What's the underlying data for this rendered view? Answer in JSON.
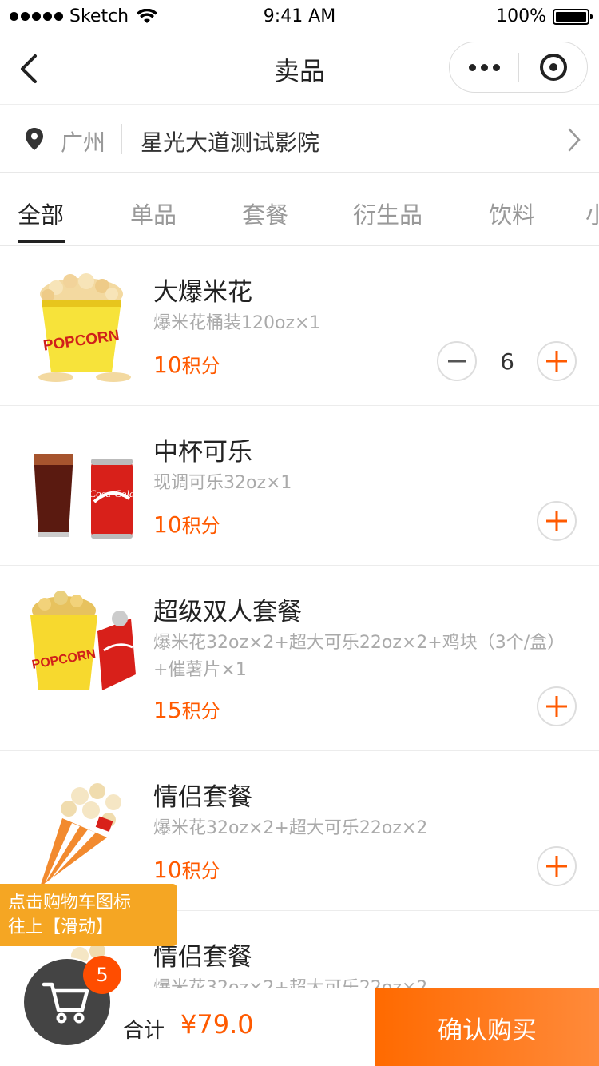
{
  "status_bar": {
    "carrier": "Sketch",
    "time": "9:41 AM",
    "battery": "100%"
  },
  "nav": {
    "title": "卖品"
  },
  "location": {
    "city": "广州",
    "cinema": "星光大道测试影院"
  },
  "tabs": [
    {
      "label": "全部",
      "active": true
    },
    {
      "label": "单品",
      "active": false
    },
    {
      "label": "套餐",
      "active": false
    },
    {
      "label": "衍生品",
      "active": false
    },
    {
      "label": "饮料",
      "active": false
    },
    {
      "label": "小",
      "active": false
    }
  ],
  "products": [
    {
      "name": "大爆米花",
      "desc": "爆米花桶装120oz×1",
      "price": "10",
      "price_unit": "积分",
      "qty": "6",
      "image": "popcorn-bucket"
    },
    {
      "name": "中杯可乐",
      "desc": "现调可乐32oz×1",
      "price": "10",
      "price_unit": "积分",
      "qty": "",
      "image": "cola-cup-and-can"
    },
    {
      "name": "超级双人套餐",
      "desc": "爆米花32oz×2+超大可乐22oz×2+鸡块（3个/盒）+催薯片×1",
      "price": "15",
      "price_unit": "积分",
      "qty": "",
      "image": "popcorn-and-cola"
    },
    {
      "name": "情侣套餐",
      "desc": "爆米花32oz×2+超大可乐22oz×2",
      "price": "10",
      "price_unit": "积分",
      "qty": "",
      "image": "popcorn-cone"
    },
    {
      "name": "情侣套餐",
      "desc": "爆米花32oz×2+超大可乐22oz×2",
      "price": "",
      "price_unit": "",
      "qty": "",
      "image": "popcorn-cone"
    }
  ],
  "hint": {
    "line1": "点击购物车图标",
    "line2": "往上【滑动】"
  },
  "cart": {
    "count": "5",
    "total_label": "合计",
    "total_value": "¥79.0",
    "confirm_label": "确认购买"
  },
  "colors": {
    "accent": "#ff5a00",
    "hint_bg": "#f5a623",
    "cart_bg": "#444444"
  }
}
